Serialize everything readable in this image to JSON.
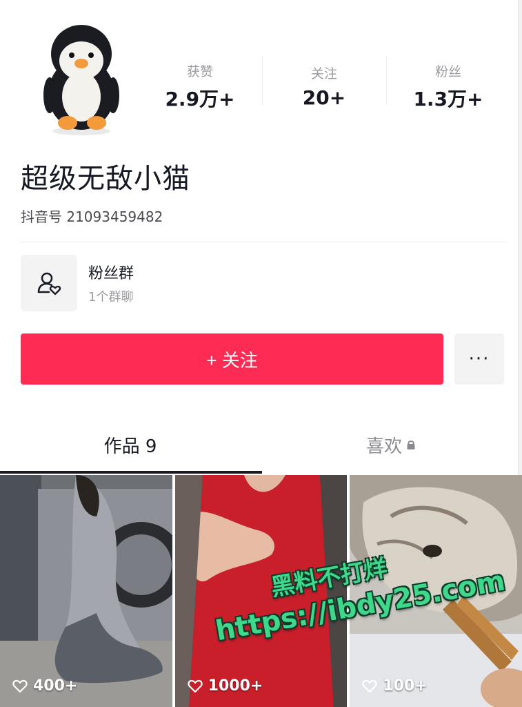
{
  "profile": {
    "nickname": "超级无敌小猫",
    "douyin_id": "抖音号 21093459482"
  },
  "stats": [
    {
      "label": "获赞",
      "value": "2.9万+"
    },
    {
      "label": "关注",
      "value": "20+"
    },
    {
      "label": "粉丝",
      "value": "1.3万+"
    }
  ],
  "fan_group": {
    "title": "粉丝群",
    "subtitle": "1个群聊"
  },
  "actions": {
    "follow_label": "+ 关注",
    "more_label": "···"
  },
  "tabs": [
    {
      "label": "作品 9",
      "active": true
    },
    {
      "label": "喜欢",
      "active": false,
      "locked": true
    }
  ],
  "videos": [
    {
      "likes": "400+"
    },
    {
      "likes": "1000+"
    },
    {
      "likes": "100+"
    }
  ],
  "watermark": {
    "line1": "黑料不打烊",
    "line2": "https://ibdy25.com"
  },
  "colors": {
    "accent": "#fe2c55",
    "watermark": "#3fd88a"
  }
}
